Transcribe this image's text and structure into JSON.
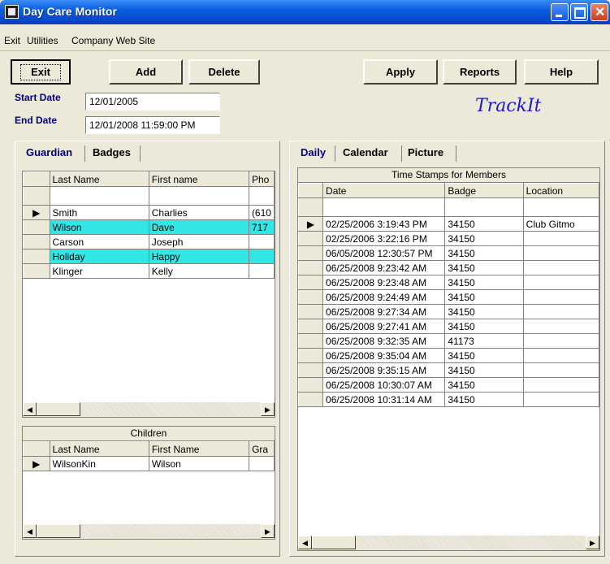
{
  "window": {
    "title": "Day Care Monitor"
  },
  "menu": [
    "Exit",
    "Utilities",
    "Company Web Site"
  ],
  "toolbar": {
    "exit": "Exit",
    "add": "Add",
    "delete": "Delete",
    "apply": "Apply",
    "reports": "Reports",
    "help": "Help"
  },
  "filters": {
    "start_label": "Start Date",
    "start_value": "12/01/2005",
    "end_label": "End Date",
    "end_value": "12/01/2008 11:59:00 PM"
  },
  "logo_text": "TrackIt",
  "left_tabs": [
    "Guardian",
    "Badges"
  ],
  "right_tabs": [
    "Daily",
    "Calendar",
    "Picture"
  ],
  "guardians": {
    "columns": [
      "Last Name",
      "First name",
      "Pho"
    ],
    "rows": [
      {
        "last": "Smith",
        "first": "Charlies",
        "phone": "(610",
        "highlight": false,
        "current": true
      },
      {
        "last": "Wilson",
        "first": "Dave",
        "phone": "717",
        "highlight": true,
        "current": false
      },
      {
        "last": "Carson",
        "first": "Joseph",
        "phone": "",
        "highlight": false,
        "current": false
      },
      {
        "last": "Holiday",
        "first": "Happy",
        "phone": "",
        "highlight": true,
        "current": false
      },
      {
        "last": "Klinger",
        "first": "Kelly",
        "phone": "",
        "highlight": false,
        "current": false
      }
    ]
  },
  "children": {
    "caption": "Children",
    "columns": [
      "Last Name",
      "First Name",
      "Gra"
    ],
    "rows": [
      {
        "last": "WilsonKin",
        "first": "Wilson",
        "grade": ""
      }
    ]
  },
  "timestamps": {
    "caption": "Time Stamps for Members",
    "columns": [
      "Date",
      "Badge",
      "Location"
    ],
    "rows": [
      {
        "date": "02/25/2006 3:19:43 PM",
        "badge": "34150",
        "location": "Club Gitmo"
      },
      {
        "date": "02/25/2006 3:22:16 PM",
        "badge": "34150",
        "location": ""
      },
      {
        "date": "06/05/2008 12:30:57 PM",
        "badge": "34150",
        "location": ""
      },
      {
        "date": "06/25/2008 9:23:42 AM",
        "badge": "34150",
        "location": ""
      },
      {
        "date": "06/25/2008 9:23:48 AM",
        "badge": "34150",
        "location": ""
      },
      {
        "date": "06/25/2008 9:24:49 AM",
        "badge": "34150",
        "location": ""
      },
      {
        "date": "06/25/2008 9:27:34 AM",
        "badge": "34150",
        "location": ""
      },
      {
        "date": "06/25/2008 9:27:41 AM",
        "badge": "34150",
        "location": ""
      },
      {
        "date": "06/25/2008 9:32:35 AM",
        "badge": "41173",
        "location": ""
      },
      {
        "date": "06/25/2008 9:35:04 AM",
        "badge": "34150",
        "location": ""
      },
      {
        "date": "06/25/2008 9:35:15 AM",
        "badge": "34150",
        "location": ""
      },
      {
        "date": "06/25/2008 10:30:07 AM",
        "badge": "34150",
        "location": ""
      },
      {
        "date": "06/25/2008 10:31:14 AM",
        "badge": "34150",
        "location": ""
      }
    ]
  },
  "colors": {
    "highlight": "#33e6e6",
    "label_blue": "#000080",
    "titlebar": "#0a5ee0"
  }
}
